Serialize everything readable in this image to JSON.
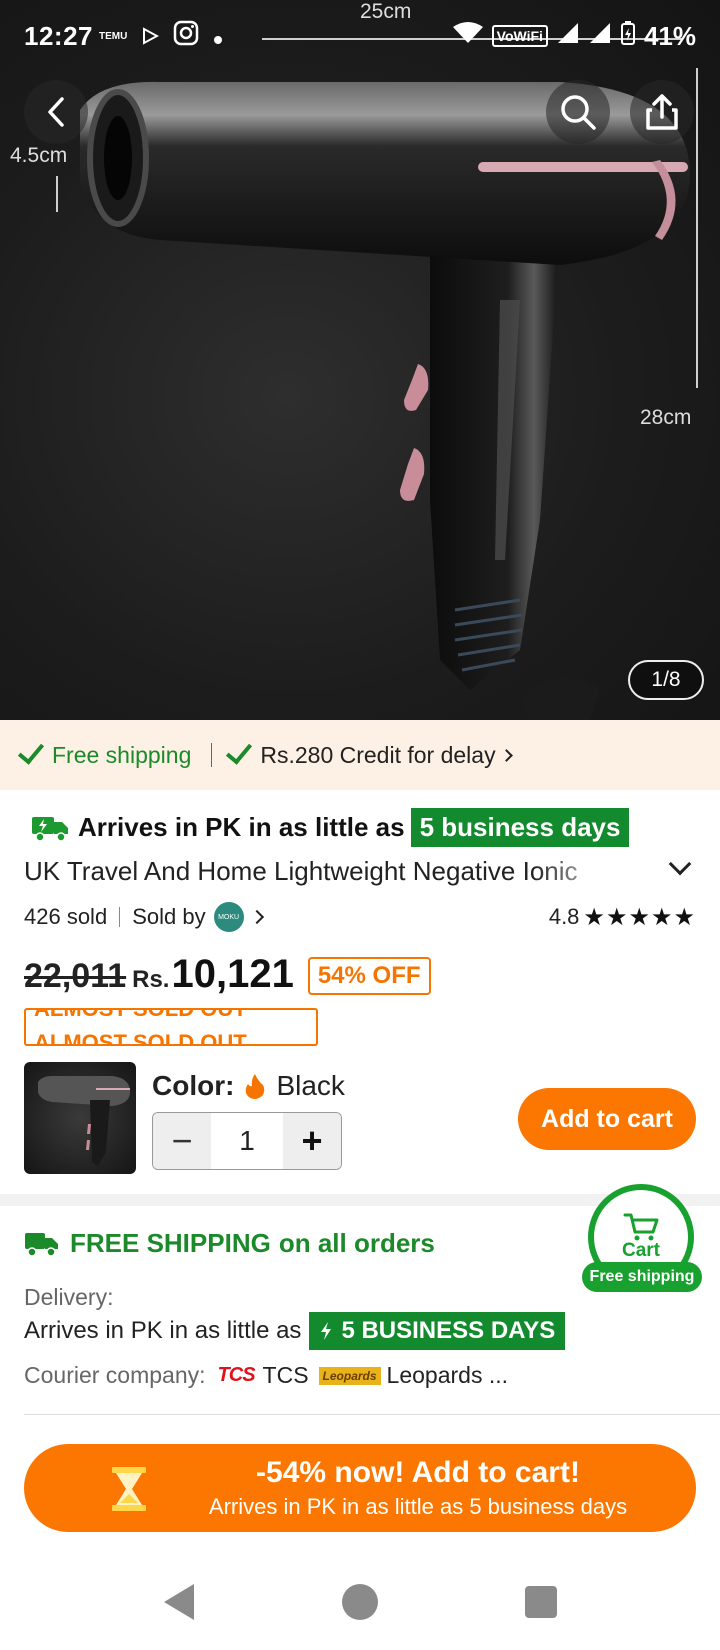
{
  "status_bar": {
    "time": "12:27",
    "temu_label": "TEMU",
    "vowifi": "VoWiFi",
    "battery": "41%"
  },
  "product_image": {
    "dimension_top": "25cm",
    "dimension_left": "4.5cm",
    "dimension_right": "28cm",
    "counter": "1/8"
  },
  "shipping_strip": {
    "free_shipping": "Free shipping",
    "credit": "Rs.280 Credit for delay"
  },
  "product": {
    "arrives_prefix": "Arrives in PK in as little as",
    "arrives_badge": "5 business days",
    "title": "UK Travel And Home Lightweight Negative Ionic",
    "sold": "426 sold",
    "sold_by": "Sold by",
    "store_logo": "MOKU",
    "rating": "4.8",
    "stars": "★★★★★",
    "old_price": "22,011",
    "currency": "Rs.",
    "price": "10,121",
    "discount": "54% OFF",
    "almost_sold_out": "ALMOST SOLD OUT"
  },
  "variant": {
    "color_label": "Color:",
    "color_value": "Black",
    "quantity": "1",
    "minus": "−",
    "plus": "+",
    "add_to_cart": "Add to cart"
  },
  "shipping_info": {
    "free_shipping_strong": "FREE SHIPPING",
    "free_shipping_rest": "on all orders",
    "delivery_label": "Delivery:",
    "delivery_text": "Arrives in PK in as little as",
    "delivery_badge": "5 BUSINESS DAYS",
    "courier_label": "Courier company:",
    "courier_tcs_logo": "TCS",
    "courier_tcs": "TCS",
    "courier_leopards_logo": "Leopards",
    "courier_leopards": "Leopards ..."
  },
  "floating_cart": {
    "label": "Cart",
    "pill": "Free shipping"
  },
  "bottom_cta": {
    "main": "-54% now! Add to cart!",
    "sub": "Arrives in PK in as little as 5 business days"
  },
  "colors": {
    "accent_orange": "#fb7701",
    "green": "#1c8a2a",
    "badge_green": "#138a2e",
    "strip_bg": "#fdf0e4"
  }
}
